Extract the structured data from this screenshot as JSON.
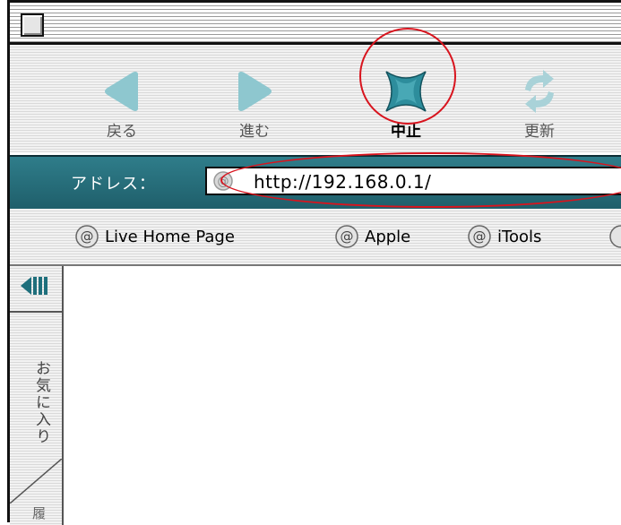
{
  "toolbar": {
    "back_label": "戻る",
    "forward_label": "進む",
    "stop_label": "中止",
    "refresh_label": "更新"
  },
  "address": {
    "label": "アドレス：",
    "value": "http://192.168.0.1/"
  },
  "favorites": [
    {
      "label": "Live Home Page"
    },
    {
      "label": "Apple"
    },
    {
      "label": "iTools"
    }
  ],
  "sidebar": {
    "tab_label": "お気に入り",
    "tab_label_2": "履"
  },
  "colors": {
    "accent": "#2f7d8a",
    "highlight_circle": "#d8141e",
    "icon_teal": "#4a9fad"
  }
}
